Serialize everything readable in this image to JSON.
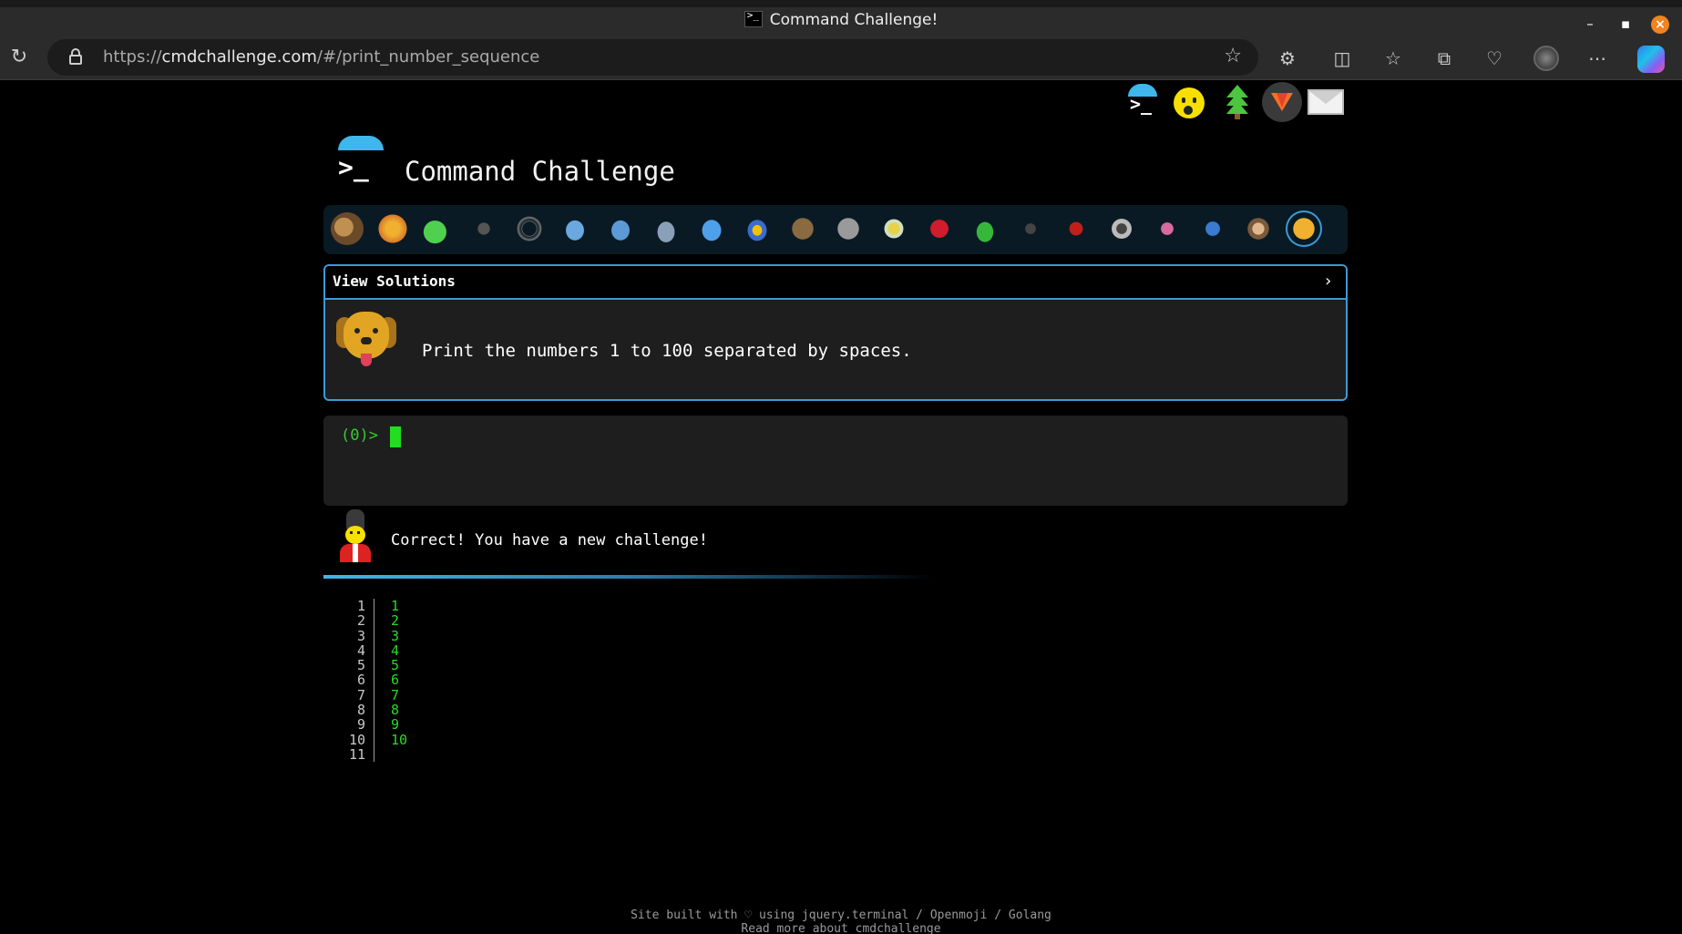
{
  "browser": {
    "window_title": "Command Challenge!",
    "url_prefix": "https://",
    "url_host": "cmdchallenge.com",
    "url_path": "/#/print_number_sequence",
    "accent_copilot": "#2f7bf5"
  },
  "page": {
    "site_title": "Command Challenge",
    "view_solutions_label": "View Solutions",
    "view_solutions_chevron": "›",
    "task_text": "Print the numbers 1 to 100 separated by spaces.",
    "prompt_text": "(0)>",
    "correct_message": "Correct! You have a new challenge!",
    "line_numbers": [
      "1",
      "2",
      "3",
      "4",
      "5",
      "6",
      "7",
      "8",
      "9",
      "10",
      "11"
    ],
    "output_values": [
      "1",
      "2",
      "3",
      "4",
      "5",
      "6",
      "7",
      "8",
      "9",
      "10"
    ],
    "footer_line1": "Site built with ♡ using jquery.terminal / Openmoji / Golang",
    "footer_line2": "Read more about cmdchallenge",
    "accent": "#3db7ec",
    "terminal_green": "#22dd22"
  },
  "top_links": [
    "terminal-icon",
    "emoji-icon",
    "tree-icon",
    "gitlab-icon",
    "mail-icon"
  ],
  "animals": [
    "snail",
    "butterfly",
    "caterpillar",
    "ant",
    "spider-web",
    "whale",
    "shark",
    "dolphin",
    "fish",
    "tropical-fish",
    "hedgehog",
    "wolf",
    "bee",
    "ladybug",
    "cricket",
    "spider",
    "scorpion",
    "fly",
    "worm",
    "microbe",
    "monkey",
    "dog"
  ]
}
